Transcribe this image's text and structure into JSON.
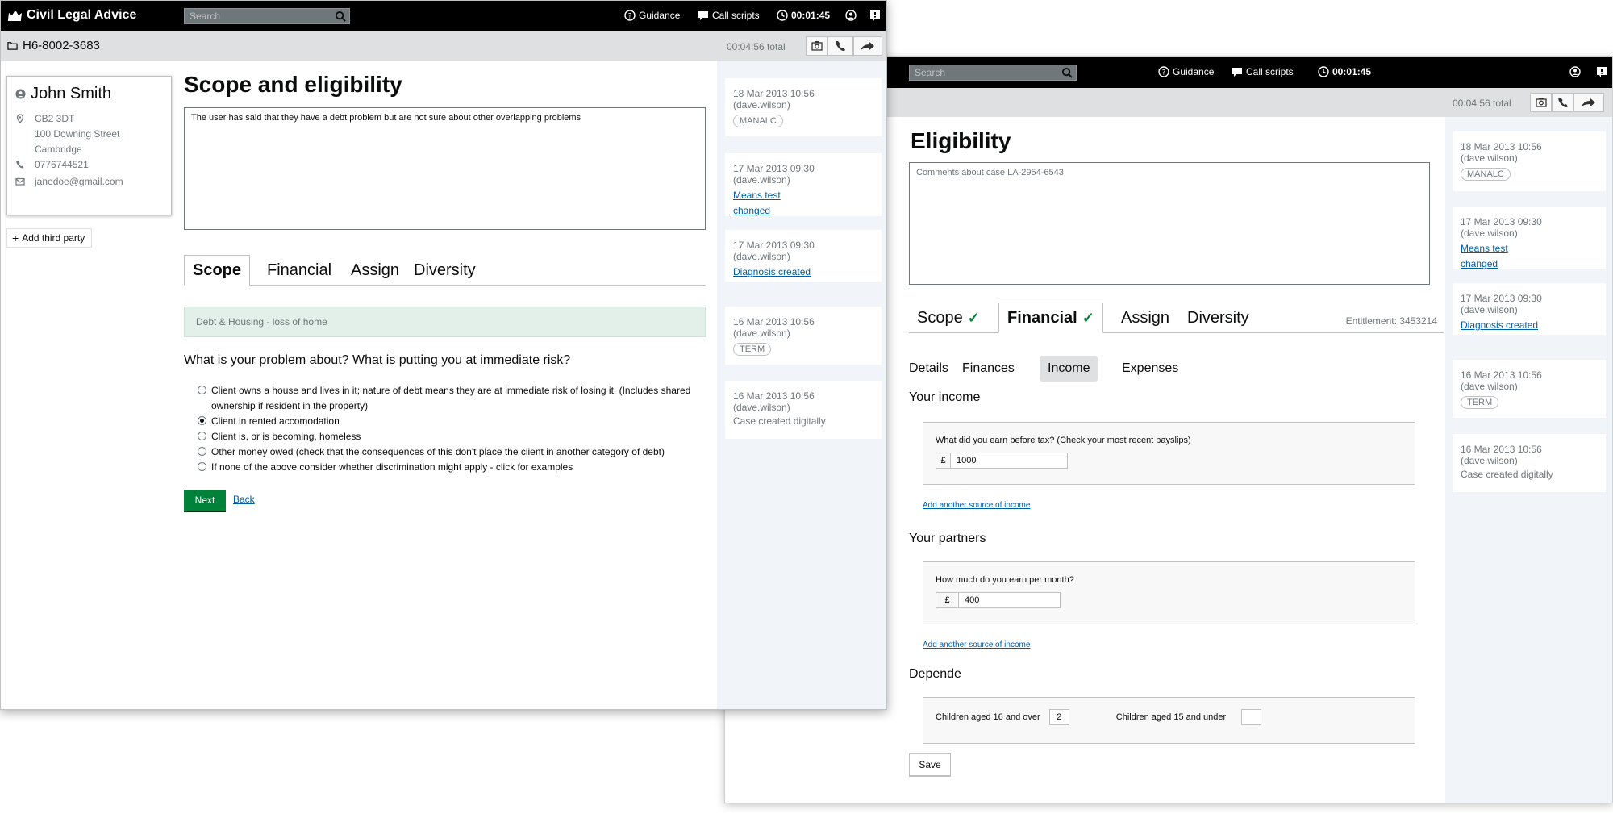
{
  "app": {
    "brand": "Civil Legal Advice",
    "search_placeholder": "Search",
    "nav": {
      "guidance": "Guidance",
      "call_scripts": "Call scripts",
      "timer": "00:01:45"
    },
    "total_time": "00:04:56 total"
  },
  "window_a": {
    "case_ref": "H6-8002-3683",
    "person": {
      "name": "John Smith",
      "postcode": "CB2 3DT",
      "street": "100 Downing Street",
      "town": "Cambridge",
      "phone": "0776744521",
      "email": "janedoe@gmail.com"
    },
    "add_third_party": "Add third party",
    "title": "Scope and eligibility",
    "notes": "The user has said that they have a debt problem but are not sure about other overlapping problems",
    "tabs": [
      "Scope",
      "Financial",
      "Assign",
      "Diversity"
    ],
    "active_tab": "Scope",
    "category": "Debt & Housing - loss of home",
    "question": "What is your problem about? What is putting you at immediate risk?",
    "options": [
      {
        "label": "Client owns a house and lives in it; nature of debt means they are at immediate risk of losing it. (Includes shared ownership if resident in the property)",
        "selected": false
      },
      {
        "label": "Client in rented accomodation",
        "selected": true
      },
      {
        "label": "Client is, or is becoming, homeless",
        "selected": false
      },
      {
        "label": "Other money owed (check that the consequences of this don't place the client in another category of debt)",
        "selected": false
      },
      {
        "label": "If none of the above consider whether discrimination might apply - click for examples",
        "selected": false
      }
    ],
    "next_label": "Next",
    "back_label": "Back"
  },
  "timeline": [
    {
      "meta": "18 Mar 2013 10:56 (dave.wilson)",
      "tag": "MANALC"
    },
    {
      "meta": "17 Mar 2013 09:30 (dave.wilson)",
      "link1": "Means test",
      "link2": "changed"
    },
    {
      "meta": "17 Mar 2013 09:30 (dave.wilson)",
      "link1": "Diagnosis created"
    },
    {
      "meta": "16 Mar 2013 10:56 (dave.wilson)",
      "tag": "TERM"
    },
    {
      "meta": "16 Mar 2013 10:56 (dave.wilson)",
      "text": "Case created digitally"
    }
  ],
  "window_b": {
    "title": "Eligibility",
    "notes_placeholder": "Comments about case LA-2954-6543",
    "tabs": [
      "Scope",
      "Financial",
      "Assign",
      "Diversity"
    ],
    "active_tab": "Financial",
    "tick_mark": "✓",
    "entitlement": "Entitlement: 3453214",
    "subtabs": [
      "Details",
      "Finances",
      "Income",
      "Expenses"
    ],
    "active_subtab": "Income",
    "your_income": {
      "heading": "Your income",
      "question": "What did you earn before tax? (Check your most recent payslips)",
      "currency": "£",
      "value": "1000",
      "add_link": "Add another source of income"
    },
    "your_partners": {
      "heading": "Your partners",
      "question": "How much do you earn per month?",
      "currency": "£",
      "value": "400",
      "add_link": "Add another source of income"
    },
    "dependents": {
      "heading": "Depende",
      "over16_label": "Children aged 16 and over",
      "over16_value": "2",
      "under15_label": "Children aged 15 and under",
      "under15_value": ""
    },
    "save_label": "Save"
  }
}
